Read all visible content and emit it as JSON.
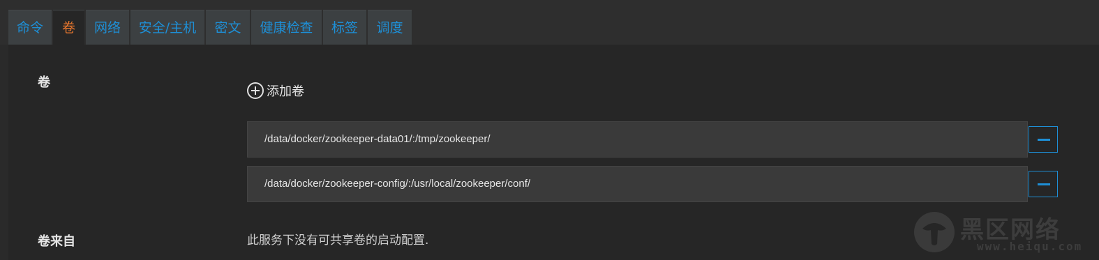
{
  "tabs": [
    {
      "label": "命令",
      "active": false
    },
    {
      "label": "卷",
      "active": true
    },
    {
      "label": "网络",
      "active": false
    },
    {
      "label": "安全/主机",
      "active": false
    },
    {
      "label": "密文",
      "active": false
    },
    {
      "label": "健康检查",
      "active": false
    },
    {
      "label": "标签",
      "active": false
    },
    {
      "label": "调度",
      "active": false
    }
  ],
  "volumes": {
    "label": "卷",
    "add_label": "添加卷",
    "items": [
      {
        "value": "/data/docker/zookeeper-data01/:/tmp/zookeeper/"
      },
      {
        "value": "/data/docker/zookeeper-config/:/usr/local/zookeeper/conf/"
      }
    ]
  },
  "volumes_from": {
    "label": "卷来自",
    "message": "此服务下没有可共享卷的启动配置."
  },
  "watermark": {
    "text": "黑区网络",
    "url": "www.heiqu.com"
  },
  "colors": {
    "accent": "#1e8fd6",
    "active_tab": "#e8772e",
    "background": "#262626"
  }
}
